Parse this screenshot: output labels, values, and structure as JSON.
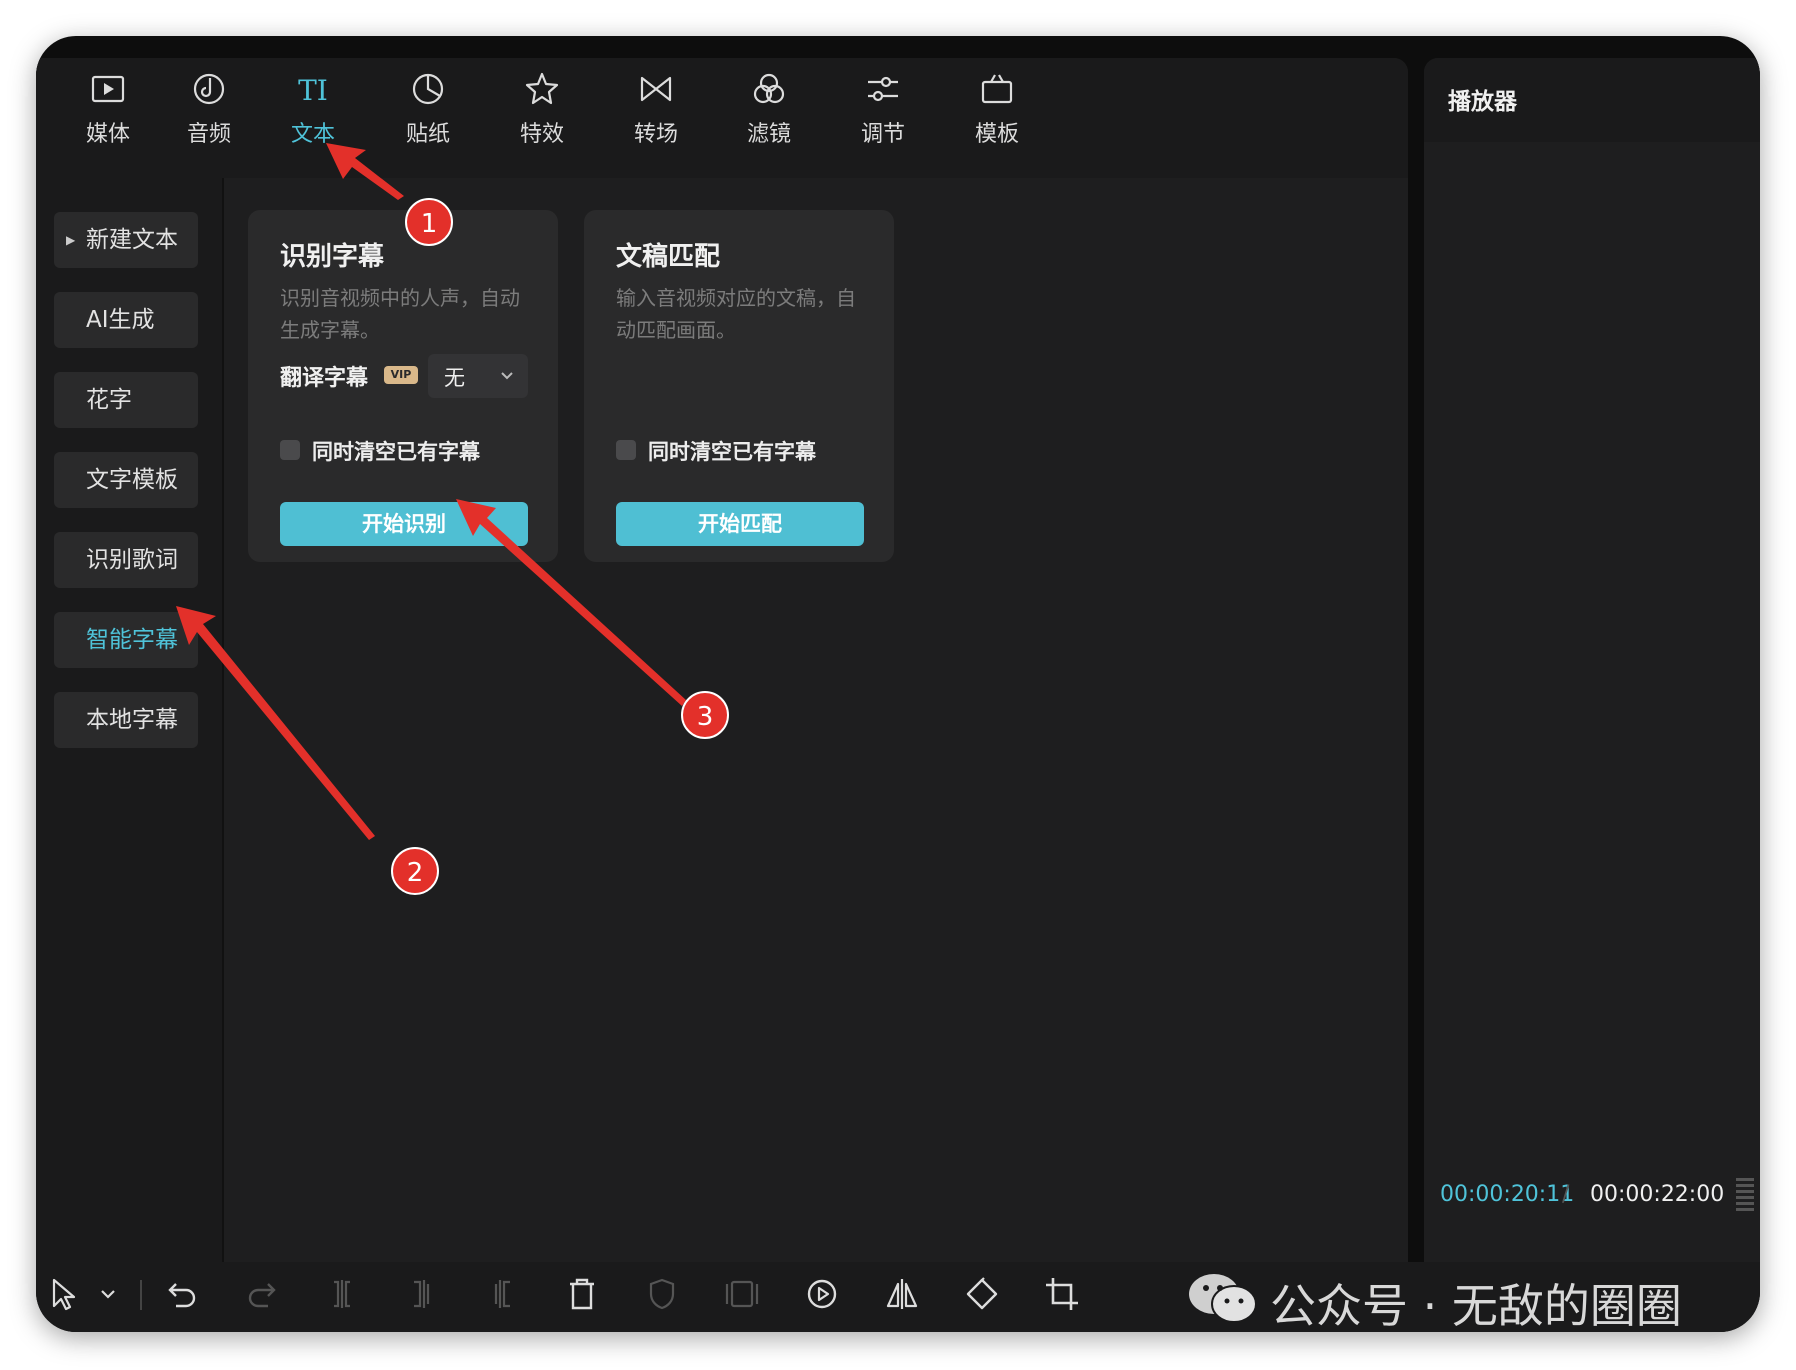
{
  "nav": {
    "tabs": [
      {
        "label": "媒体",
        "icon": "media-icon"
      },
      {
        "label": "音频",
        "icon": "audio-icon"
      },
      {
        "label": "文本",
        "icon": "text-icon",
        "active": true
      },
      {
        "label": "贴纸",
        "icon": "sticker-icon"
      },
      {
        "label": "特效",
        "icon": "effects-icon"
      },
      {
        "label": "转场",
        "icon": "transition-icon"
      },
      {
        "label": "滤镜",
        "icon": "filter-icon"
      },
      {
        "label": "调节",
        "icon": "adjust-icon"
      },
      {
        "label": "模板",
        "icon": "template-icon"
      }
    ],
    "active_color": "#4fc3d9"
  },
  "sidebar": {
    "items": [
      {
        "label": "新建文本"
      },
      {
        "label": "AI生成"
      },
      {
        "label": "花字"
      },
      {
        "label": "文字模板"
      },
      {
        "label": "识别歌词"
      },
      {
        "label": "智能字幕",
        "active": true
      },
      {
        "label": "本地字幕"
      }
    ]
  },
  "cards": {
    "recognize": {
      "title": "识别字幕",
      "desc": "识别音视频中的人声，自动生成字幕。",
      "translate_label": "翻译字幕",
      "vip_badge": "VIP",
      "translate_value": "无",
      "clear_label": "同时清空已有字幕",
      "button": "开始识别"
    },
    "match": {
      "title": "文稿匹配",
      "desc": "输入音视频对应的文稿，自动匹配画面。",
      "clear_label": "同时清空已有字幕",
      "button": "开始匹配"
    },
    "button_color": "#4fbfd3"
  },
  "player": {
    "title": "播放器",
    "current_time": "00:00:20:11",
    "separator": "/",
    "total_time": "00:00:22:00"
  },
  "toolbar": {
    "tools": [
      "select-arrow-icon",
      "chevron-down-icon",
      "undo-icon",
      "redo-icon",
      "split-icon",
      "split-left-icon",
      "split-right-icon",
      "delete-icon",
      "shield-icon",
      "freeze-icon",
      "play-circle-icon",
      "mirror-icon",
      "rotate-icon",
      "crop-icon"
    ]
  },
  "watermark": {
    "text": "公众号 · 无敌的圈圈",
    "icon": "wechat-icon"
  },
  "annotations": {
    "color": "#e3302a",
    "badges": [
      "1",
      "2",
      "3"
    ]
  }
}
